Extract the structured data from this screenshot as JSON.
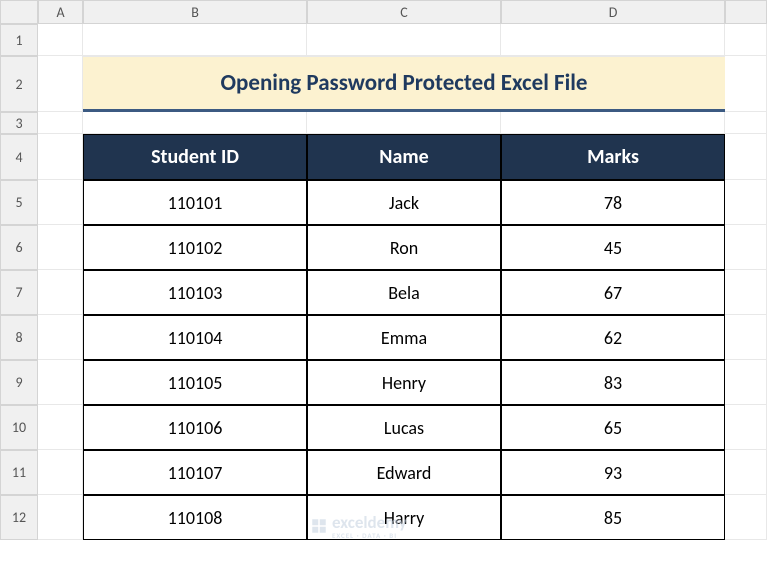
{
  "columns": [
    "A",
    "B",
    "C",
    "D"
  ],
  "rows": [
    "1",
    "2",
    "3",
    "4",
    "5",
    "6",
    "7",
    "8",
    "9",
    "10",
    "11",
    "12"
  ],
  "title": "Opening Password Protected Excel File",
  "table": {
    "headers": [
      "Student ID",
      "Name",
      "Marks"
    ],
    "rows": [
      [
        "110101",
        "Jack",
        "78"
      ],
      [
        "110102",
        "Ron",
        "45"
      ],
      [
        "110103",
        "Bela",
        "67"
      ],
      [
        "110104",
        "Emma",
        "62"
      ],
      [
        "110105",
        "Henry",
        "83"
      ],
      [
        "110106",
        "Lucas",
        "65"
      ],
      [
        "110107",
        "Edward",
        "93"
      ],
      [
        "110108",
        "Harry",
        "85"
      ]
    ]
  },
  "watermark": {
    "main": "exceldemy",
    "sub": "EXCEL · DATA · BI"
  },
  "chart_data": {
    "type": "table",
    "title": "Opening Password Protected Excel File",
    "columns": [
      "Student ID",
      "Name",
      "Marks"
    ],
    "data": [
      {
        "Student ID": 110101,
        "Name": "Jack",
        "Marks": 78
      },
      {
        "Student ID": 110102,
        "Name": "Ron",
        "Marks": 45
      },
      {
        "Student ID": 110103,
        "Name": "Bela",
        "Marks": 67
      },
      {
        "Student ID": 110104,
        "Name": "Emma",
        "Marks": 62
      },
      {
        "Student ID": 110105,
        "Name": "Henry",
        "Marks": 83
      },
      {
        "Student ID": 110106,
        "Name": "Lucas",
        "Marks": 65
      },
      {
        "Student ID": 110107,
        "Name": "Edward",
        "Marks": 93
      },
      {
        "Student ID": 110108,
        "Name": "Harry",
        "Marks": 85
      }
    ]
  }
}
